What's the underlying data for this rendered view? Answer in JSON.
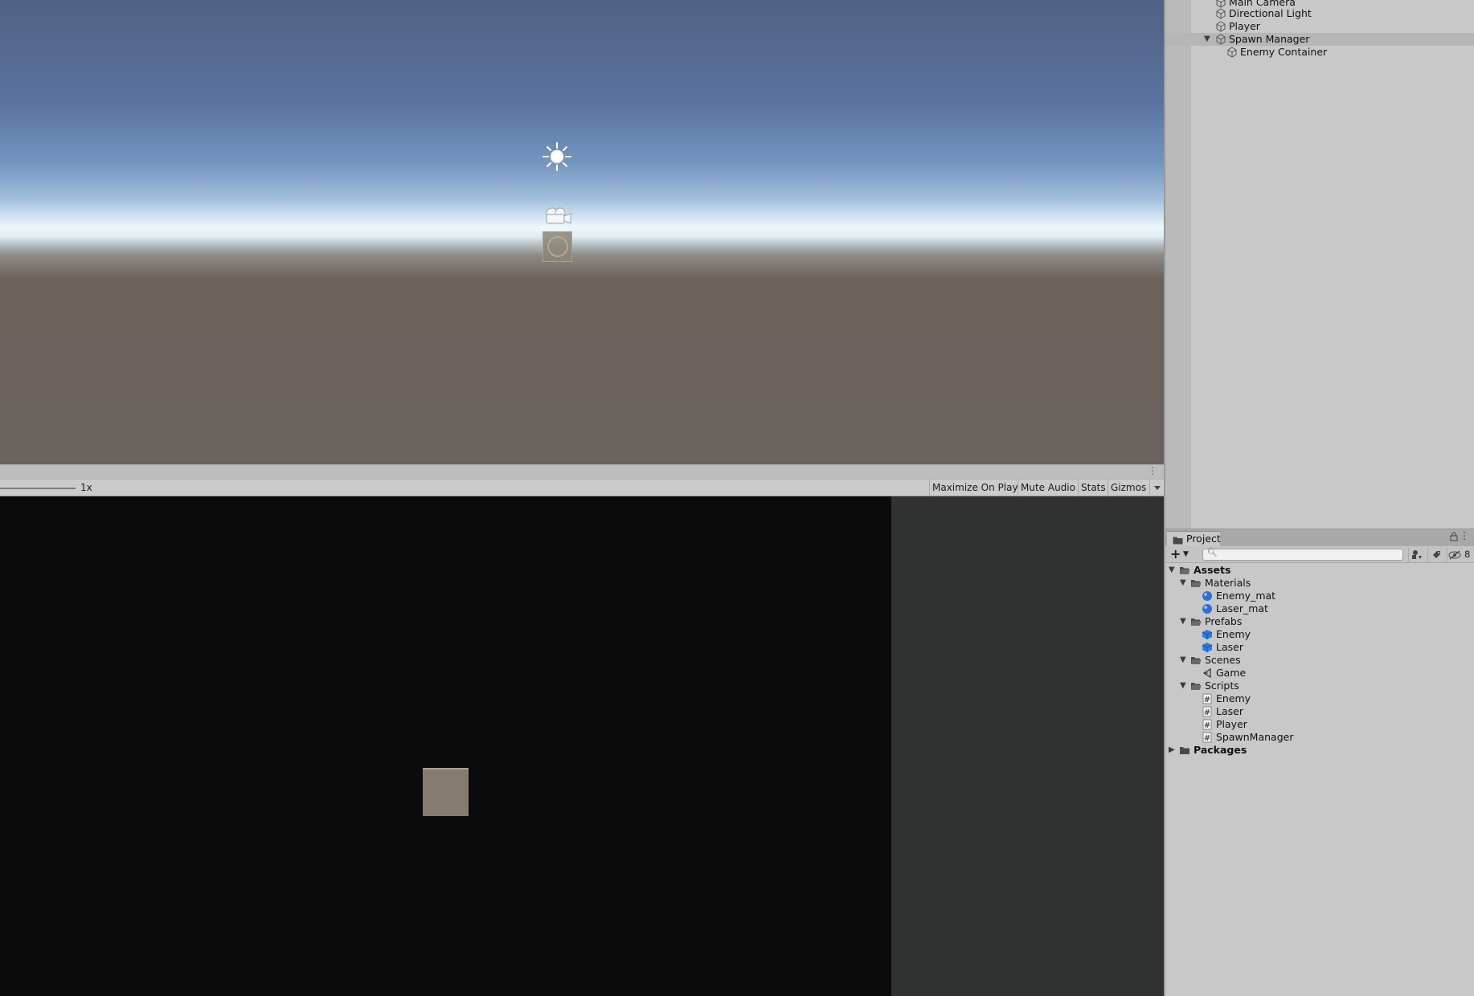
{
  "scene_view": {
    "gizmos": [
      "sun-icon",
      "camera-icon",
      "sphere-icon"
    ]
  },
  "game_toolbar": {
    "scale_value": "1x",
    "maximize_on_play": "Maximize On Play",
    "mute_audio": "Mute Audio",
    "stats": "Stats",
    "gizmos": "Gizmos"
  },
  "hierarchy": {
    "items": [
      {
        "label": "Main Camera"
      },
      {
        "label": "Directional Light"
      },
      {
        "label": "Player"
      },
      {
        "label": "Spawn Manager"
      },
      {
        "label": "Enemy Container"
      }
    ]
  },
  "project": {
    "tab_label": "Project",
    "search_placeholder": "",
    "hidden_count": "8",
    "tree": [
      {
        "label": "Assets",
        "icon": "folder-open-icon"
      },
      {
        "label": "Materials",
        "icon": "folder-open-icon"
      },
      {
        "label": "Enemy_mat",
        "icon": "material-icon"
      },
      {
        "label": "Laser_mat",
        "icon": "material-icon"
      },
      {
        "label": "Prefabs",
        "icon": "folder-open-icon"
      },
      {
        "label": "Enemy",
        "icon": "prefab-icon"
      },
      {
        "label": "Laser",
        "icon": "prefab-icon"
      },
      {
        "label": "Scenes",
        "icon": "folder-open-icon"
      },
      {
        "label": "Game",
        "icon": "scene-icon"
      },
      {
        "label": "Scripts",
        "icon": "folder-open-icon"
      },
      {
        "label": "Enemy",
        "icon": "script-icon"
      },
      {
        "label": "Laser",
        "icon": "script-icon"
      },
      {
        "label": "Player",
        "icon": "script-icon"
      },
      {
        "label": "SpawnManager",
        "icon": "script-icon"
      },
      {
        "label": "Packages",
        "icon": "folder-closed-icon"
      }
    ]
  },
  "colors": {
    "sky_top": "#4f6283",
    "ground": "#6a625e",
    "game_background": "#0b0b0b",
    "player_cube": "#857c6f",
    "material_icon": "#2f6fd0",
    "prefab_icon": "#2f7ae0"
  }
}
